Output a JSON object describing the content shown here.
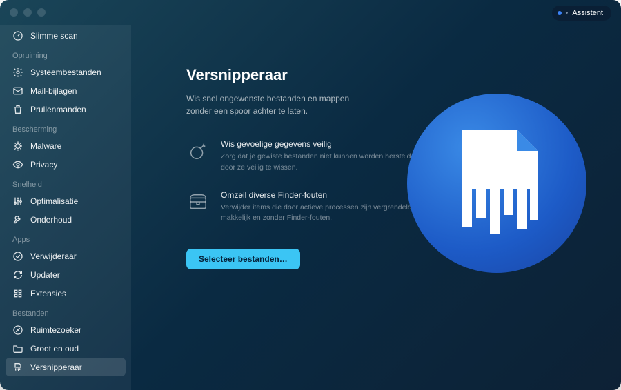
{
  "header": {
    "assistent_label": "Assistent"
  },
  "sidebar": {
    "top_item": {
      "label": "Slimme scan"
    },
    "sections": [
      {
        "label": "Opruiming",
        "items": [
          {
            "label": "Systeembestanden",
            "icon": "system-icon"
          },
          {
            "label": "Mail-bijlagen",
            "icon": "mail-icon"
          },
          {
            "label": "Prullenmanden",
            "icon": "trash-icon"
          }
        ]
      },
      {
        "label": "Bescherming",
        "items": [
          {
            "label": "Malware",
            "icon": "bug-icon"
          },
          {
            "label": "Privacy",
            "icon": "eye-icon"
          }
        ]
      },
      {
        "label": "Snelheid",
        "items": [
          {
            "label": "Optimalisatie",
            "icon": "sliders-icon"
          },
          {
            "label": "Onderhoud",
            "icon": "wrench-icon"
          }
        ]
      },
      {
        "label": "Apps",
        "items": [
          {
            "label": "Verwijderaar",
            "icon": "uninstall-icon"
          },
          {
            "label": "Updater",
            "icon": "refresh-icon"
          },
          {
            "label": "Extensies",
            "icon": "puzzle-icon"
          }
        ]
      },
      {
        "label": "Bestanden",
        "items": [
          {
            "label": "Ruimtezoeker",
            "icon": "compass-icon"
          },
          {
            "label": "Groot en oud",
            "icon": "folder-icon"
          },
          {
            "label": "Versnipperaar",
            "icon": "shredder-icon",
            "active": true
          }
        ]
      }
    ]
  },
  "main": {
    "title": "Versnipperaar",
    "subtitle": "Wis snel ongewenste bestanden en mappen zonder een spoor achter te laten.",
    "features": [
      {
        "title": "Wis gevoelige gegevens veilig",
        "desc": "Zorg dat je gewiste bestanden niet kunnen worden hersteld door ze veilig te wissen."
      },
      {
        "title": "Omzeil diverse Finder-fouten",
        "desc": "Verwijder items die door actieve processen zijn vergrendeld makkelijk en zonder Finder-fouten."
      }
    ],
    "primary_button": "Selecteer bestanden…"
  },
  "colors": {
    "accent": "#3bc5f4",
    "hero_light": "#3a8ae6",
    "hero_dark": "#1944a3"
  }
}
